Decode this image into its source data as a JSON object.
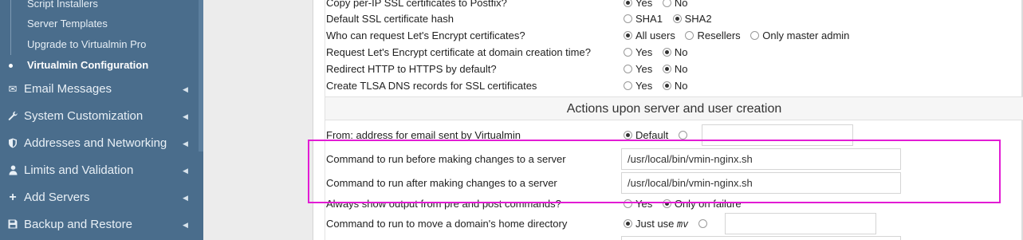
{
  "sidebar": {
    "sub_items": [
      {
        "label": "Script Installers",
        "active": false
      },
      {
        "label": "Server Templates",
        "active": false
      },
      {
        "label": "Upgrade to Virtualmin Pro",
        "active": false
      },
      {
        "label": "Virtualmin Configuration",
        "active": true
      }
    ],
    "menu_items": [
      {
        "label": "Email Messages",
        "icon": "envelope-icon",
        "glyph": "✉"
      },
      {
        "label": "System Customization",
        "icon": "wrench-icon",
        "glyph": "🔧"
      },
      {
        "label": "Addresses and Networking",
        "icon": "shield-icon",
        "glyph": "⛨"
      },
      {
        "label": "Limits and Validation",
        "icon": "user-icon",
        "glyph": "👤"
      },
      {
        "label": "Add Servers",
        "icon": "plus-icon",
        "glyph": "+"
      },
      {
        "label": "Backup and Restore",
        "icon": "save-icon",
        "glyph": "💾"
      }
    ]
  },
  "ssl_rows": [
    {
      "question": "Copy per-IP SSL certificates to Postfix?",
      "options": [
        {
          "label": "Yes",
          "selected": true
        },
        {
          "label": "No",
          "selected": false
        }
      ]
    },
    {
      "question": "Default SSL certificate hash",
      "options": [
        {
          "label": "SHA1",
          "selected": false
        },
        {
          "label": "SHA2",
          "selected": true
        }
      ]
    },
    {
      "question": "Who can request Let's Encrypt certificates?",
      "options": [
        {
          "label": "All users",
          "selected": true
        },
        {
          "label": "Resellers",
          "selected": false
        },
        {
          "label": "Only master admin",
          "selected": false
        }
      ]
    },
    {
      "question": "Request Let's Encrypt certificate at domain creation time?",
      "options": [
        {
          "label": "Yes",
          "selected": false
        },
        {
          "label": "No",
          "selected": true
        }
      ]
    },
    {
      "question": "Redirect HTTP to HTTPS by default?",
      "options": [
        {
          "label": "Yes",
          "selected": false
        },
        {
          "label": "No",
          "selected": true
        }
      ]
    },
    {
      "question": "Create TLSA DNS records for SSL certificates",
      "options": [
        {
          "label": "Yes",
          "selected": false
        },
        {
          "label": "No",
          "selected": true
        }
      ]
    }
  ],
  "section": {
    "title": "Actions upon server and user creation"
  },
  "from_address": {
    "question": "From: address for email sent by Virtualmin",
    "default_label": "Default",
    "value": ""
  },
  "pre_command": {
    "question": "Command to run before making changes to a server",
    "value": "/usr/local/bin/vmin-nginx.sh"
  },
  "post_command": {
    "question": "Command to run after making changes to a server",
    "value": "/usr/local/bin/vmin-nginx.sh"
  },
  "output_row": {
    "question": "Always show output from pre and post commands?",
    "yes_label": "Yes",
    "failure_label": "Only on failure"
  },
  "move_row": {
    "question": "Command to run to move a domain's home directory",
    "just_use_label": "Just use",
    "command": "mv",
    "value": ""
  },
  "colors": {
    "sidebar_bg": "#4a6d8c",
    "highlight": "#e21cd4"
  }
}
